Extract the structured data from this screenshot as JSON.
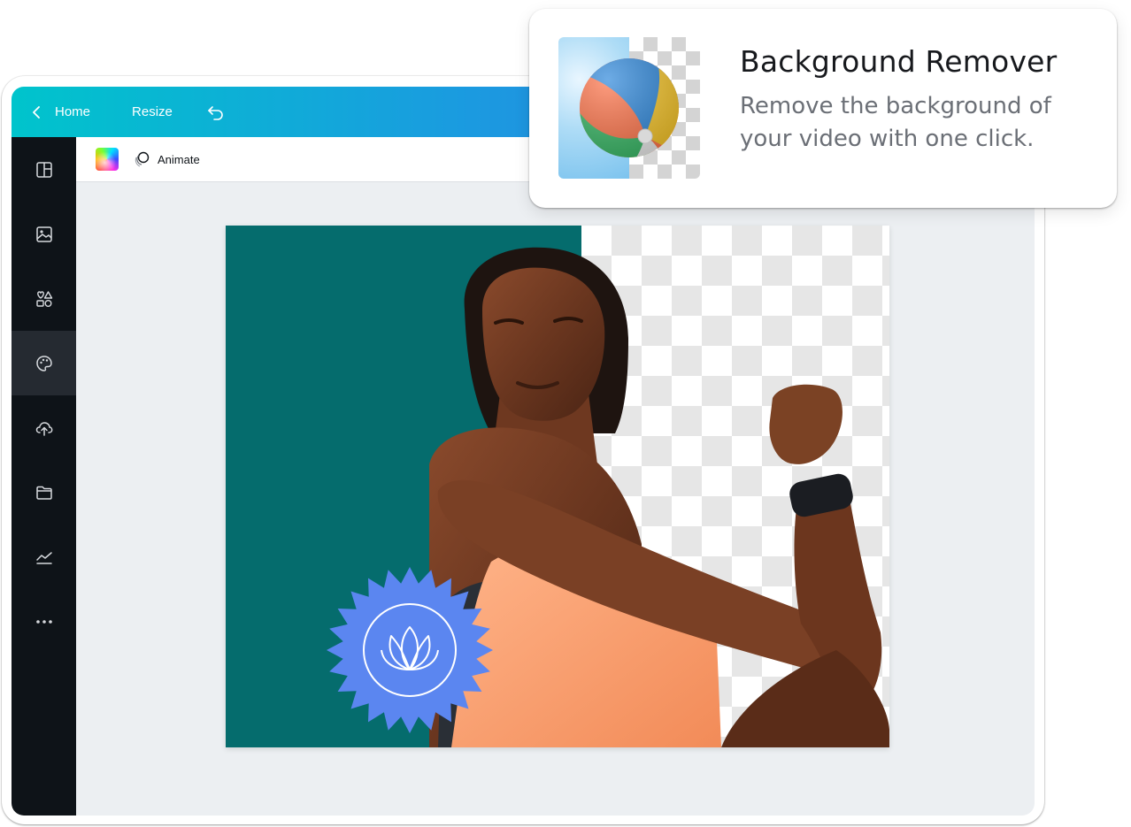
{
  "topbar": {
    "home_label": "Home",
    "resize_label": "Resize",
    "gradient_colors": [
      "#00c4cc",
      "#1b9ae0",
      "#3b6fe0"
    ]
  },
  "sidebar": {
    "items": [
      {
        "icon": "templates-icon"
      },
      {
        "icon": "photos-icon"
      },
      {
        "icon": "elements-icon"
      },
      {
        "icon": "styles-icon",
        "active": true
      },
      {
        "icon": "uploads-icon"
      },
      {
        "icon": "folder-icon"
      },
      {
        "icon": "charts-icon"
      },
      {
        "icon": "more-icon"
      }
    ]
  },
  "toolbar": {
    "color_icon": "color-palette-icon",
    "animate_label": "Animate"
  },
  "canvas": {
    "accent_color": "#056c6d",
    "badge_color": "#5b86f0"
  },
  "feature_card": {
    "title": "Background Remover",
    "description": "Remove the background of your video with one click."
  }
}
